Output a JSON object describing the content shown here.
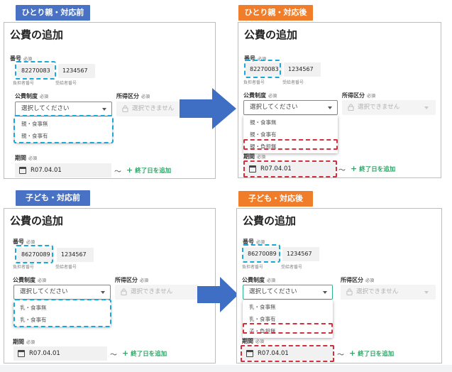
{
  "panels": [
    {
      "tag": "ひとり親・対応前",
      "title": "公費の追加",
      "number_label": "番号",
      "required": "必須",
      "payer_number": "82270083",
      "recipient_number": "1234567",
      "payer_caption": "負担者番号",
      "recipient_caption": "受給者番号",
      "system_label": "公費制度",
      "income_label": "所得区分",
      "select_placeholder": "選択してください",
      "disabled_placeholder": "選択できません",
      "options": [
        "親・食事無",
        "親・食事有"
      ],
      "period_label": "期間",
      "date_value": "R07.04.01",
      "tilde": "〜",
      "add_end_label": "終了日を追加"
    },
    {
      "tag": "ひとり親・対応後",
      "title": "公費の追加",
      "number_label": "番号",
      "required": "必須",
      "payer_number": "82270083",
      "recipient_number": "1234567",
      "payer_caption": "負担者番号",
      "recipient_caption": "受給者番号",
      "system_label": "公費制度",
      "income_label": "所得区分",
      "select_placeholder": "選択してください",
      "disabled_placeholder": "選択できません",
      "options": [
        "親・食事無",
        "親・食事有",
        "親・負担無"
      ],
      "period_label": "期間",
      "date_value": "R07.04.01",
      "tilde": "〜",
      "add_end_label": "終了日を追加"
    },
    {
      "tag": "子ども・対応前",
      "title": "公費の追加",
      "number_label": "番号",
      "required": "必須",
      "payer_number": "86270089",
      "recipient_number": "1234567",
      "payer_caption": "負担者番号",
      "recipient_caption": "受給者番号",
      "system_label": "公費制度",
      "income_label": "所得区分",
      "select_placeholder": "選択してください",
      "disabled_placeholder": "選択できません",
      "options": [
        "乳・食事無",
        "乳・食事有"
      ],
      "period_label": "期間",
      "date_value": "R07.04.01",
      "tilde": "〜",
      "add_end_label": "終了日を追加"
    },
    {
      "tag": "子ども・対応後",
      "title": "公費の追加",
      "number_label": "番号",
      "required": "必須",
      "payer_number": "86270089",
      "recipient_number": "1234567",
      "payer_caption": "負担者番号",
      "recipient_caption": "受給者番号",
      "system_label": "公費制度",
      "income_label": "所得区分",
      "select_placeholder": "選択してください",
      "disabled_placeholder": "選択できません",
      "options": [
        "乳・食事無",
        "乳・食事有",
        "子・負担無"
      ],
      "period_label": "期間",
      "date_value": "R07.04.01",
      "tilde": "〜",
      "add_end_label": "終了日を追加"
    }
  ],
  "colors": {
    "before_tag": "#4a72c4",
    "after_tag": "#f07d2a",
    "select_border": "#2eb58c",
    "add_link": "#2aa866",
    "highlight_existing": "#1aa7d9",
    "highlight_new": "#d32f3c",
    "arrow": "#3f6fc4"
  },
  "icons": [
    "calendar-icon",
    "lock-icon",
    "plus-icon",
    "chevron-down-icon",
    "arrow-right-icon"
  ]
}
